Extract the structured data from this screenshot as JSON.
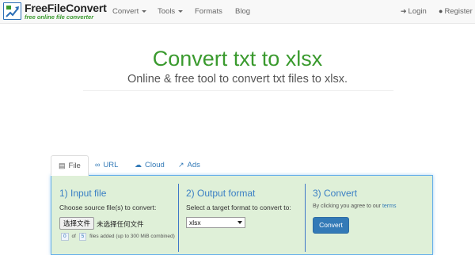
{
  "brand": {
    "name": "FreeFileConvert",
    "tagline": "free online file converter",
    "colors": {
      "green": "#3a9a2e",
      "blue": "#337ab7"
    }
  },
  "nav": {
    "items": [
      {
        "label": "Convert",
        "dropdown": true
      },
      {
        "label": "Tools",
        "dropdown": true
      },
      {
        "label": "Formats",
        "dropdown": false
      },
      {
        "label": "Blog",
        "dropdown": false
      }
    ],
    "right": [
      {
        "label": "Login",
        "icon": "login-icon"
      },
      {
        "label": "Register",
        "icon": "user-icon"
      }
    ]
  },
  "hero": {
    "title": "Convert txt to xlsx",
    "subtitle": "Online & free tool to convert txt files to xlsx."
  },
  "tabs": [
    {
      "label": "File",
      "icon": "monitor-icon",
      "active": true
    },
    {
      "label": "URL",
      "icon": "link-icon",
      "active": false
    },
    {
      "label": "Cloud",
      "icon": "cloud-icon",
      "active": false
    },
    {
      "label": "Ads",
      "icon": "external-link-icon",
      "active": false
    }
  ],
  "panel": {
    "input": {
      "title": "1) Input file",
      "instruction": "Choose source file(s) to convert:",
      "choose_button": "选择文件",
      "no_file": "未选择任何文件",
      "count": "0",
      "of_label": "of",
      "max": "5",
      "added_text": "files added (up to 300 MiB combined)"
    },
    "output": {
      "title": "2) Output format",
      "instruction": "Select a target format to convert to:",
      "selected_format": "xlsx"
    },
    "convert": {
      "title": "3) Convert",
      "agree_prefix": "By clicking you agree to our",
      "terms_link": "terms",
      "button": "Convert"
    }
  }
}
